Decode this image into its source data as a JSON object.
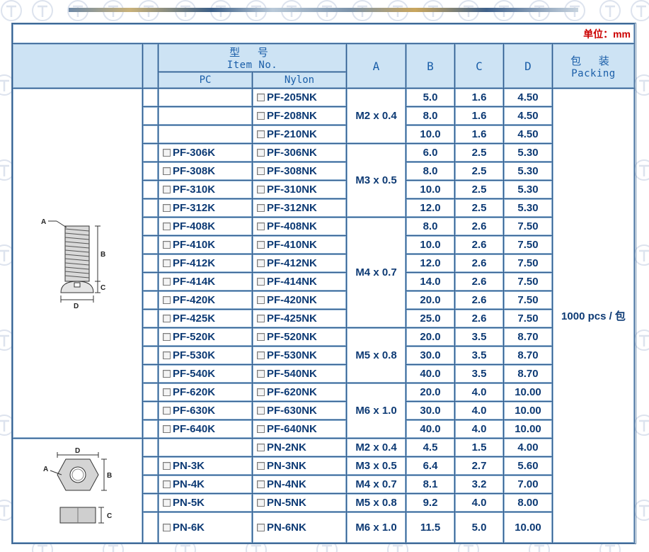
{
  "unit_label": "单位：mm",
  "header": {
    "model_cn": "型 号",
    "model_en": "Item No.",
    "pc": "PC",
    "nylon": "Nylon",
    "col_a": "A",
    "col_b": "B",
    "col_c": "C",
    "col_d": "D",
    "packing_cn": "包 装",
    "packing_en": "Packing"
  },
  "packing_value": "1000 pcs / 包",
  "threads": [
    "M2 x 0.4",
    "M3 x 0.5",
    "M4 x 0.7",
    "M5 x 0.8",
    "M6 x 1.0"
  ],
  "diagram_labels": {
    "a": "A",
    "b": "B",
    "c": "C",
    "d": "D"
  },
  "rows": [
    {
      "pc": "",
      "nylon": "PF-205NK",
      "b": "5.0",
      "c": "1.6",
      "d": "4.50"
    },
    {
      "pc": "",
      "nylon": "PF-208NK",
      "b": "8.0",
      "c": "1.6",
      "d": "4.50"
    },
    {
      "pc": "",
      "nylon": "PF-210NK",
      "b": "10.0",
      "c": "1.6",
      "d": "4.50"
    },
    {
      "pc": "PF-306K",
      "nylon": "PF-306NK",
      "b": "6.0",
      "c": "2.5",
      "d": "5.30"
    },
    {
      "pc": "PF-308K",
      "nylon": "PF-308NK",
      "b": "8.0",
      "c": "2.5",
      "d": "5.30"
    },
    {
      "pc": "PF-310K",
      "nylon": "PF-310NK",
      "b": "10.0",
      "c": "2.5",
      "d": "5.30"
    },
    {
      "pc": "PF-312K",
      "nylon": "PF-312NK",
      "b": "12.0",
      "c": "2.5",
      "d": "5.30"
    },
    {
      "pc": "PF-408K",
      "nylon": "PF-408NK",
      "b": "8.0",
      "c": "2.6",
      "d": "7.50"
    },
    {
      "pc": "PF-410K",
      "nylon": "PF-410NK",
      "b": "10.0",
      "c": "2.6",
      "d": "7.50"
    },
    {
      "pc": "PF-412K",
      "nylon": "PF-412NK",
      "b": "12.0",
      "c": "2.6",
      "d": "7.50"
    },
    {
      "pc": "PF-414K",
      "nylon": "PF-414NK",
      "b": "14.0",
      "c": "2.6",
      "d": "7.50"
    },
    {
      "pc": "PF-420K",
      "nylon": "PF-420NK",
      "b": "20.0",
      "c": "2.6",
      "d": "7.50"
    },
    {
      "pc": "PF-425K",
      "nylon": "PF-425NK",
      "b": "25.0",
      "c": "2.6",
      "d": "7.50"
    },
    {
      "pc": "PF-520K",
      "nylon": "PF-520NK",
      "b": "20.0",
      "c": "3.5",
      "d": "8.70"
    },
    {
      "pc": "PF-530K",
      "nylon": "PF-530NK",
      "b": "30.0",
      "c": "3.5",
      "d": "8.70"
    },
    {
      "pc": "PF-540K",
      "nylon": "PF-540NK",
      "b": "40.0",
      "c": "3.5",
      "d": "8.70"
    },
    {
      "pc": "PF-620K",
      "nylon": "PF-620NK",
      "b": "20.0",
      "c": "4.0",
      "d": "10.00"
    },
    {
      "pc": "PF-630K",
      "nylon": "PF-630NK",
      "b": "30.0",
      "c": "4.0",
      "d": "10.00"
    },
    {
      "pc": "PF-640K",
      "nylon": "PF-640NK",
      "b": "40.0",
      "c": "4.0",
      "d": "10.00"
    },
    {
      "pc": "",
      "nylon": "PN-2NK",
      "b": "4.5",
      "c": "1.5",
      "d": "4.00"
    },
    {
      "pc": "PN-3K",
      "nylon": "PN-3NK",
      "b": "6.4",
      "c": "2.7",
      "d": "5.60"
    },
    {
      "pc": "PN-4K",
      "nylon": "PN-4NK",
      "b": "8.1",
      "c": "3.2",
      "d": "7.00"
    },
    {
      "pc": "PN-5K",
      "nylon": "PN-5NK",
      "b": "9.2",
      "c": "4.0",
      "d": "8.00"
    },
    {
      "pc": "PN-6K",
      "nylon": "PN-6NK",
      "b": "11.5",
      "c": "5.0",
      "d": "10.00"
    }
  ],
  "colors": {
    "header_bg": "#cde3f4",
    "header_text": "#1a5ea8",
    "cell_text": "#0d3a74",
    "grid": "#2e5a8c",
    "unit_text": "#cc0000"
  }
}
